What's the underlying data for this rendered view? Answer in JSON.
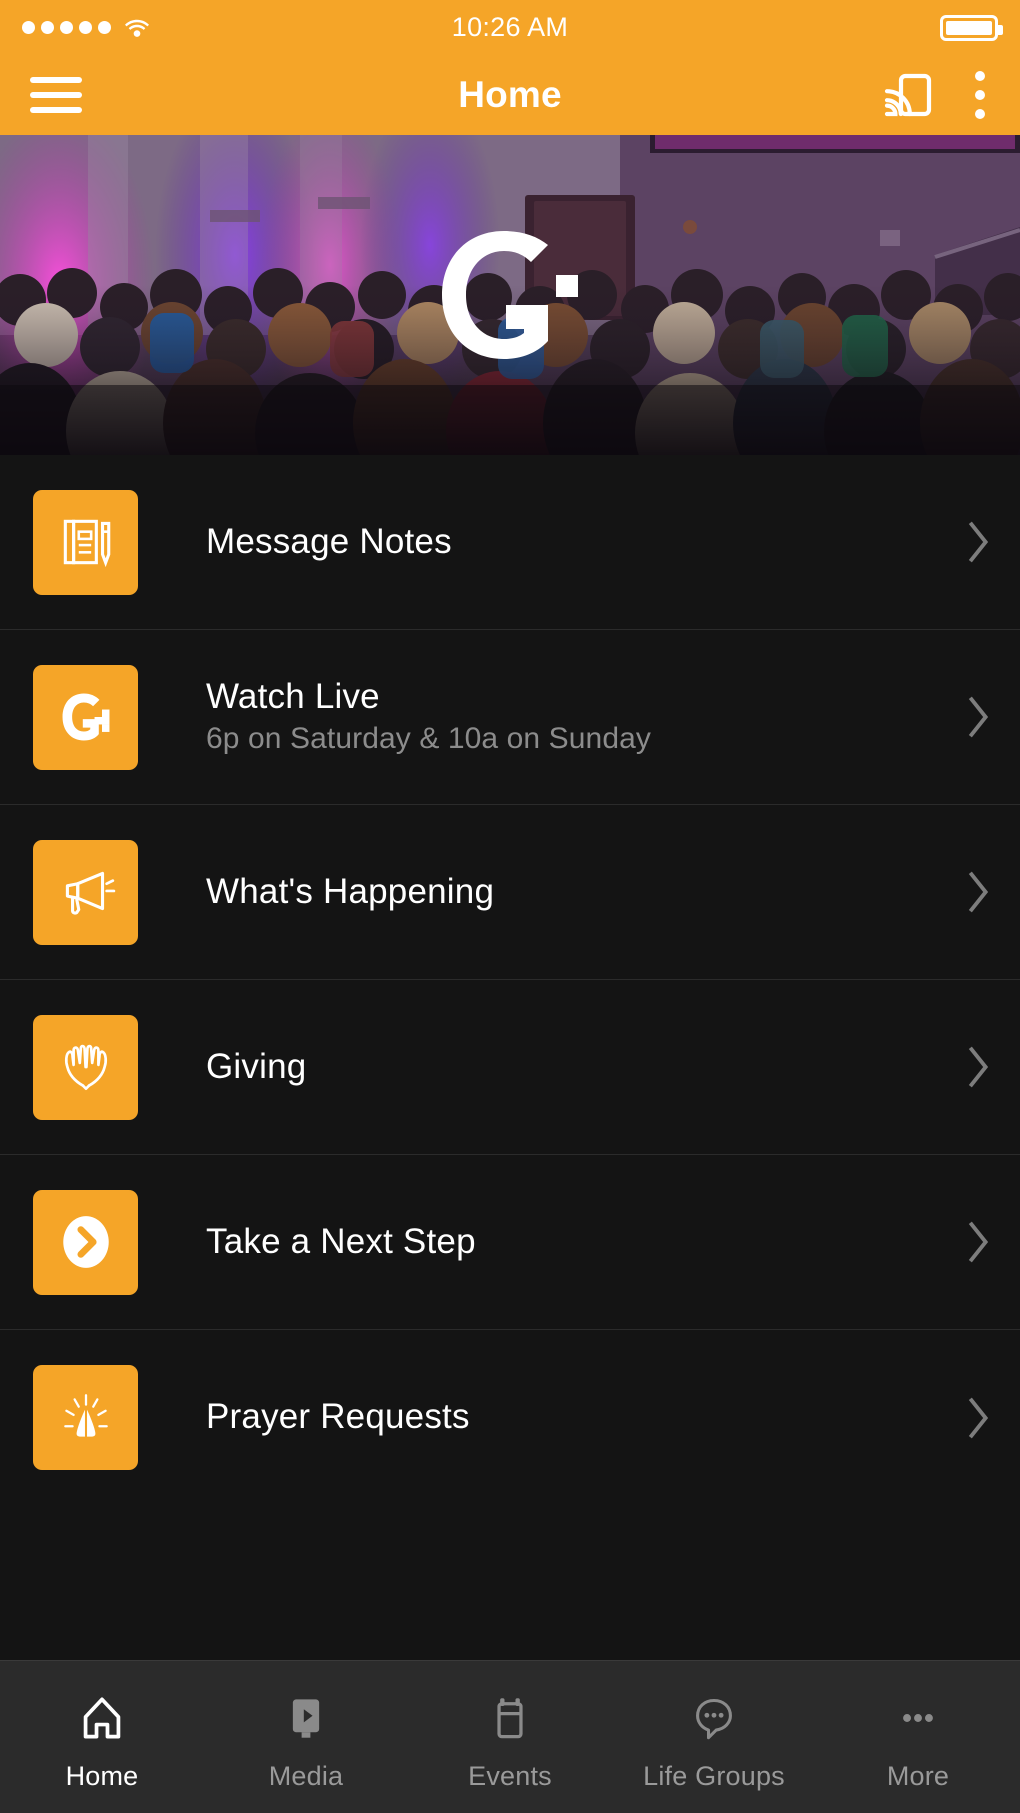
{
  "theme": {
    "brand_orange": "#f5a528",
    "list_background": "#141414",
    "tabbar_background": "#2b2b2b",
    "title_text": "#ffffff",
    "subtitle_text": "#8c8c8c",
    "inactive_tab_text": "#9a9a9a"
  },
  "status_bar": {
    "signal_dots": 5,
    "wifi_icon": "wifi-icon",
    "time": "10:26 AM",
    "battery_icon": "battery-full-icon"
  },
  "navbar": {
    "menu_icon": "hamburger-menu-icon",
    "title": "Home",
    "cast_icon": "chromecast-icon",
    "overflow_icon": "overflow-menu-icon"
  },
  "hero": {
    "alt": "Church congregation standing in auditorium with purple stage lighting",
    "logo_icon": "g-church-logo"
  },
  "menu": {
    "items": [
      {
        "title": "Message Notes",
        "subtitle": "",
        "icon": "notebook-pencil-icon",
        "chevron": "chevron-right-icon"
      },
      {
        "title": "Watch Live",
        "subtitle": "6p on Saturday & 10a on Sunday",
        "icon": "g-logo-icon",
        "chevron": "chevron-right-icon"
      },
      {
        "title": "What's Happening",
        "subtitle": "",
        "icon": "megaphone-icon",
        "chevron": "chevron-right-icon"
      },
      {
        "title": "Giving",
        "subtitle": "",
        "icon": "open-hands-icon",
        "chevron": "chevron-right-icon"
      },
      {
        "title": "Take a Next Step",
        "subtitle": "",
        "icon": "circle-chevron-icon",
        "chevron": "chevron-right-icon"
      },
      {
        "title": "Prayer Requests",
        "subtitle": "",
        "icon": "praying-hands-icon",
        "chevron": "chevron-right-icon"
      }
    ]
  },
  "tabbar": {
    "items": [
      {
        "label": "Home",
        "icon": "home-icon",
        "active": true
      },
      {
        "label": "Media",
        "icon": "media-device-play-icon",
        "active": false
      },
      {
        "label": "Events",
        "icon": "calendar-icon",
        "active": false
      },
      {
        "label": "Life Groups",
        "icon": "speech-bubble-dots-icon",
        "active": false
      },
      {
        "label": "More",
        "icon": "ellipsis-icon",
        "active": false
      }
    ]
  }
}
